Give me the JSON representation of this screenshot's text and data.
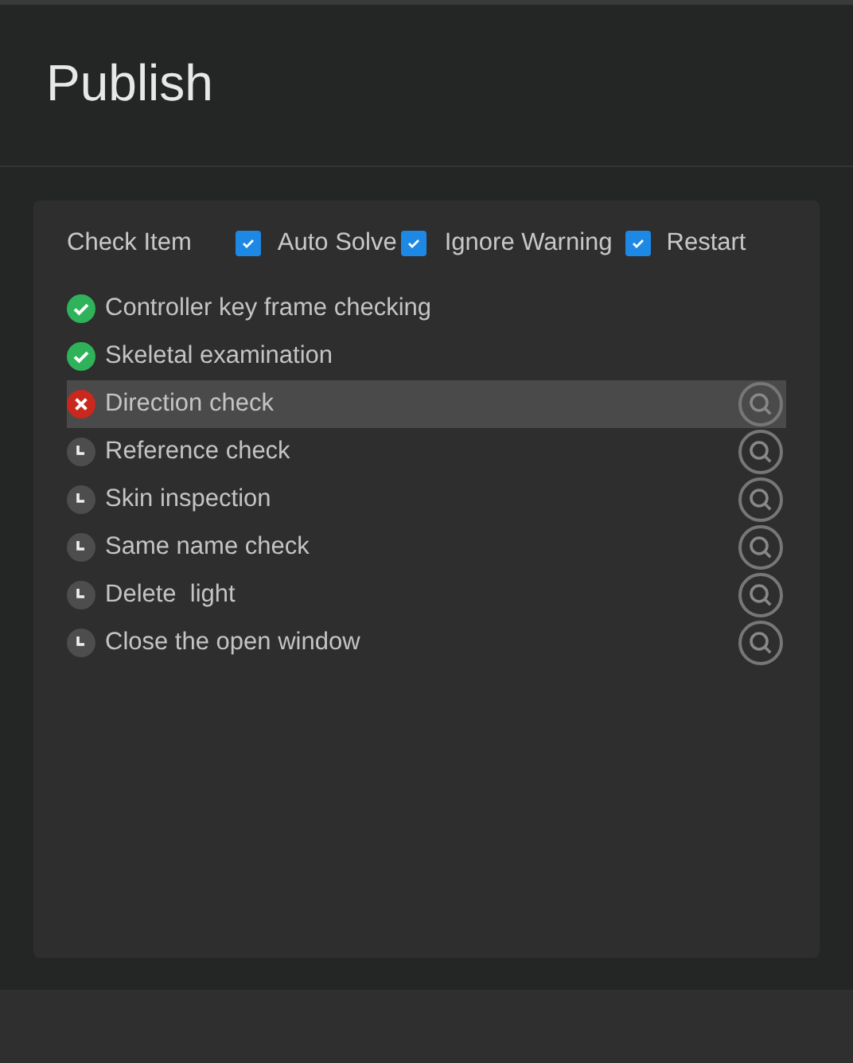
{
  "window": {
    "title": "Publish"
  },
  "header": {
    "label": "Check Item",
    "options": [
      {
        "label": "Auto Solve",
        "checked": true
      },
      {
        "label": "Ignore Warning",
        "checked": true
      },
      {
        "label": "Restart",
        "checked": true
      }
    ]
  },
  "checks": [
    {
      "label": "Controller key frame checking",
      "kind": "pass",
      "selected": false
    },
    {
      "label": "Skeletal examination",
      "kind": "pass",
      "selected": false
    },
    {
      "label": "Direction check",
      "kind": "fail",
      "selected": true
    },
    {
      "label": "Reference check",
      "kind": "pending",
      "selected": false
    },
    {
      "label": "Skin inspection",
      "kind": "pending",
      "selected": false
    },
    {
      "label": "Same name check",
      "kind": "pending",
      "selected": false
    },
    {
      "label": "Delete  light",
      "kind": "pending",
      "selected": false
    },
    {
      "label": "Close the open window",
      "kind": "pending",
      "selected": false
    }
  ]
}
